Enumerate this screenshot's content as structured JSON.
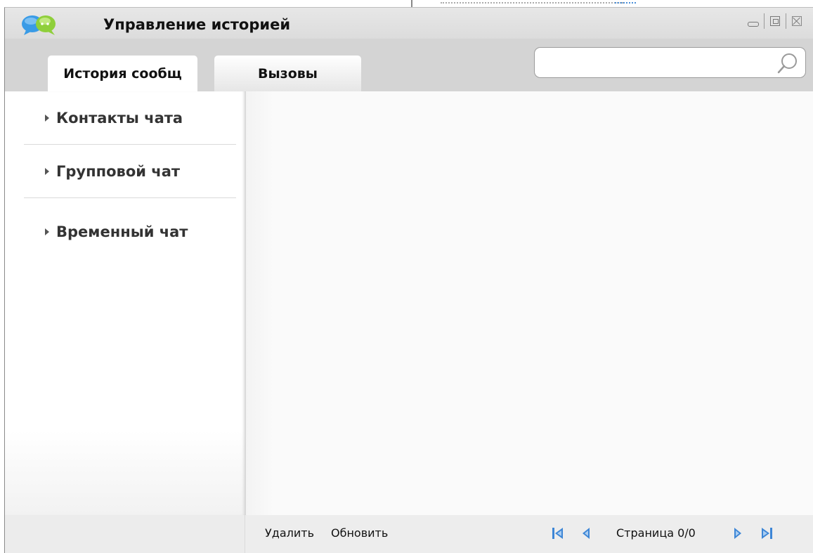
{
  "window": {
    "title": "Управление историей",
    "controls": [
      "minimize-icon",
      "maximize-icon",
      "close-icon"
    ]
  },
  "tabs": [
    {
      "label": "История сообщ",
      "active": true
    },
    {
      "label": "Вызовы",
      "active": false
    }
  ],
  "search": {
    "value": "",
    "placeholder": ""
  },
  "sidebar": {
    "items": [
      {
        "label": "Контакты чата"
      },
      {
        "label": "Групповой чат"
      },
      {
        "label": "Временный чат"
      }
    ]
  },
  "footer": {
    "delete_label": "Удалить",
    "refresh_label": "Обновить",
    "page_label": "Страница 0/0"
  },
  "colors": {
    "chrome": "#d4d4d4",
    "pager_blue": "#3d86d6",
    "logo_blue": "#3a9be6",
    "logo_green": "#8fcf3b"
  }
}
